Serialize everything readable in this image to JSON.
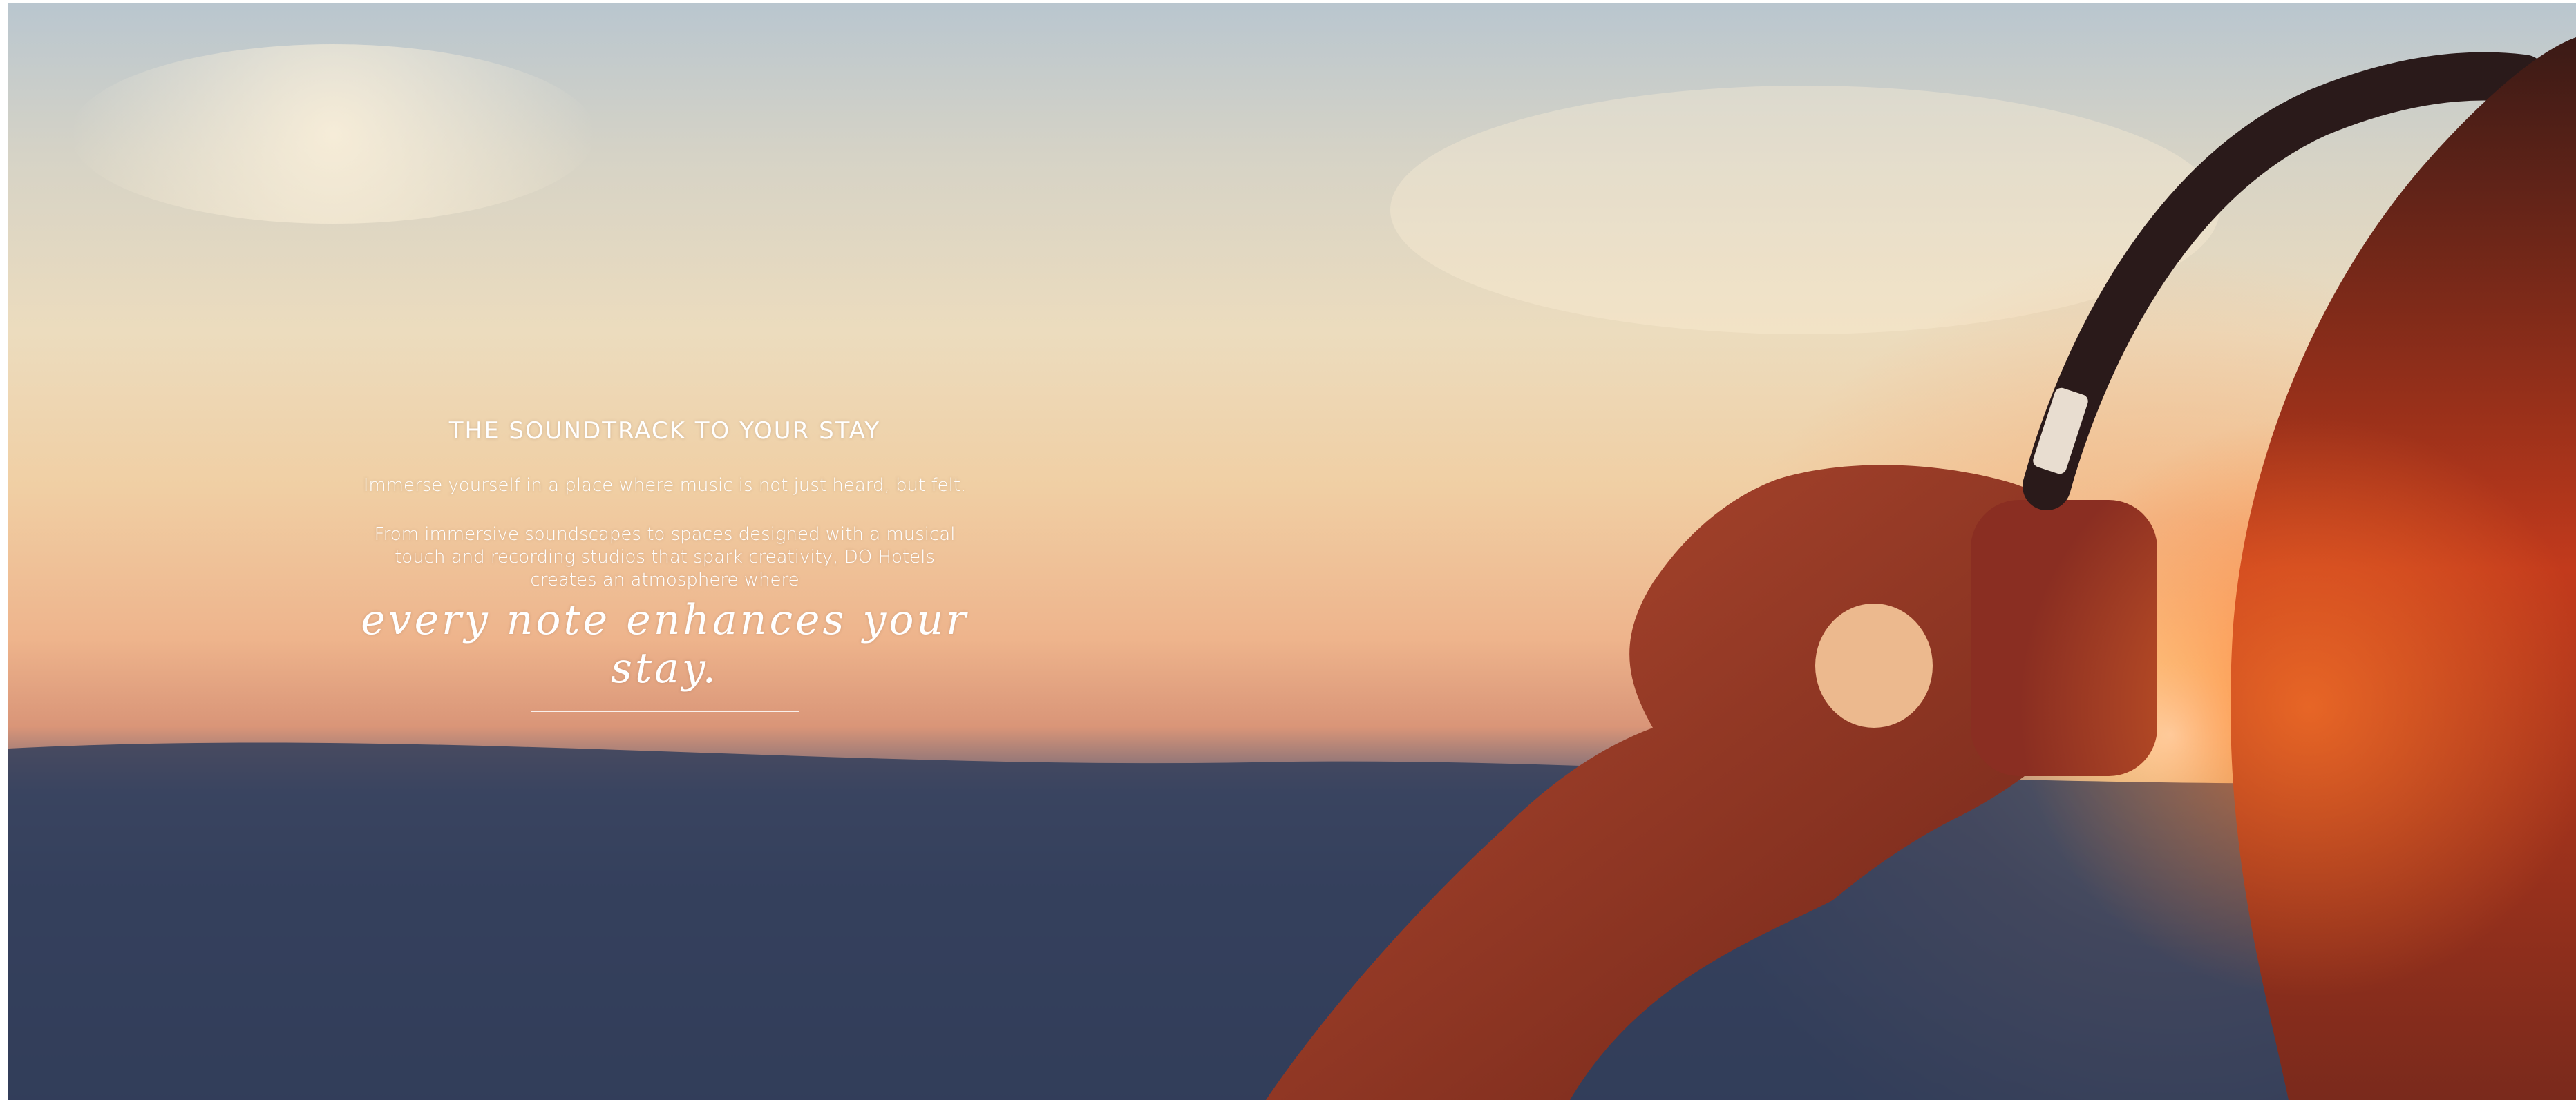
{
  "hero": {
    "title": "THE SOUNDTRACK TO YOUR STAY",
    "lead": "Immerse yourself in a place where music is not just heard, but felt.",
    "body": "From immersive soundscapes to spaces designed with a musical touch and recording studios that spark creativity, DO Hotels creates an atmosphere where",
    "script": "every note enhances your stay."
  },
  "colors": {
    "text": "#ffffff",
    "sky_top": "#b9c6cf",
    "sunset": "#eeb48c",
    "horizon": "#3c4663"
  }
}
